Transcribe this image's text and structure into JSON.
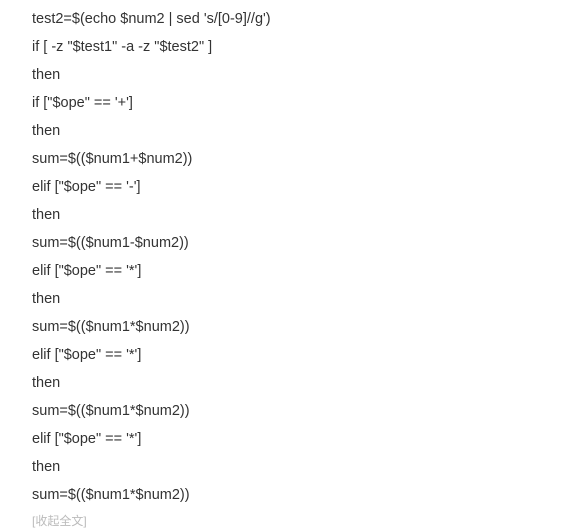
{
  "code_lines": [
    "test2=$(echo $num2 | sed 's/[0-9]//g')",
    "if [ -z \"$test1\" -a -z \"$test2\" ]",
    "then",
    "if [\"$ope\" == '+']",
    "then",
    "sum=$(($num1+$num2))",
    "elif [\"$ope\" == '-']",
    "then",
    "sum=$(($num1-$num2))",
    "elif [\"$ope\" == '*']",
    "then",
    "sum=$(($num1*$num2))",
    "elif [\"$ope\" == '*']",
    "then",
    "sum=$(($num1*$num2))",
    "elif [\"$ope\" == '*']",
    "then",
    "sum=$(($num1*$num2))"
  ],
  "footer": {
    "collapse_label": "[收起全文]"
  }
}
